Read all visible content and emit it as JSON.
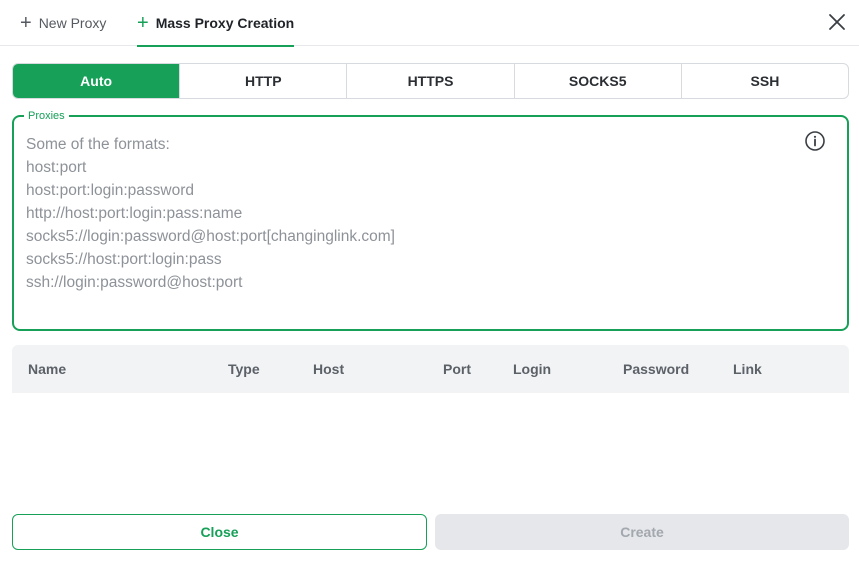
{
  "header": {
    "tabs": [
      {
        "label": "New Proxy",
        "active": false
      },
      {
        "label": "Mass Proxy Creation",
        "active": true
      }
    ],
    "close_icon": "close-icon"
  },
  "types": {
    "options": [
      "Auto",
      "HTTP",
      "HTTPS",
      "SOCKS5",
      "SSH"
    ],
    "selected": "Auto"
  },
  "proxies": {
    "label": "Proxies",
    "value": "",
    "placeholder": "Some of the formats:\nhost:port\nhost:port:login:password\nhttp://host:port:login:pass:name\nsocks5://login:password@host:port[changinglink.com]\nsocks5://host:port:login:pass\nssh://login:password@host:port",
    "info_icon": "info-icon"
  },
  "table": {
    "columns": [
      "Name",
      "Type",
      "Host",
      "Port",
      "Login",
      "Password",
      "Link"
    ],
    "rows": []
  },
  "footer": {
    "close_label": "Close",
    "create_label": "Create",
    "create_disabled": true
  },
  "colors": {
    "accent": "#16a058",
    "disabled_bg": "#e5e7ea",
    "disabled_text": "#a3a8ae"
  }
}
